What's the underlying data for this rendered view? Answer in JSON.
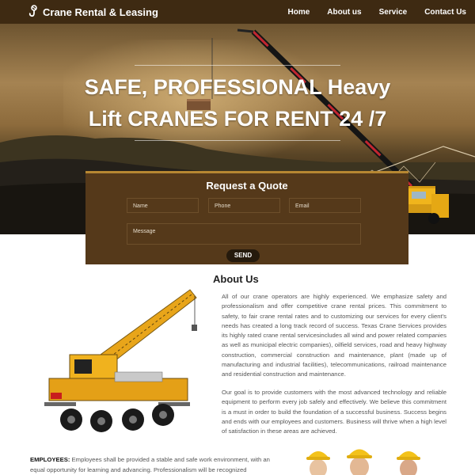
{
  "header": {
    "brand": "Crane Rental & Leasing",
    "nav": [
      "Home",
      "About us",
      "Service",
      "Contact Us"
    ]
  },
  "hero": {
    "title_line1": "SAFE, PROFESSIONAL Heavy",
    "title_line2": "Lift CRANES FOR RENT 24 /7"
  },
  "quote": {
    "title": "Request a Quote",
    "name_placeholder": "Name",
    "phone_placeholder": "Phone",
    "email_placeholder": "Email",
    "message_placeholder": "Message",
    "send_label": "SEND"
  },
  "about": {
    "title": "About  Us",
    "paragraph1": "All of our crane operators are highly experienced.  We emphasize safety and professionalism and offer competitive crane rental prices. This commitment to safety, to fair crane rental rates and to customizing our services for every client's needs has created a long track record of success. Texas Crane Services provides its highly rated crane rental servicesincludes all wind and power related companies as well as municipal electric companies), oilfield services, road and heavy highway construction, commercial construction and maintenance, plant (made up of manufacturing and industrial facilities), telecommunications, railroad maintenance and residential construction and maintenance.",
    "paragraph2": "Our goal is to provide customers with the most advanced technology and reliable equipment to perform every job safely and effectively. We believe this commitment is a must in order to build the foundation of a successful business. Success begins and ends with our employees and customers. Business will thrive when a high level of satisfaction in these areas are achieved."
  },
  "employees": {
    "label": "EMPLOYEES:",
    "text": " Employees shall be provided a stable and safe work environment, with an equal opportunity for learning and advancing. Professionalism will be recognized"
  },
  "colors": {
    "header_bg": "#3e2a12",
    "form_bg": "#55391a",
    "accent": "#b78732"
  }
}
